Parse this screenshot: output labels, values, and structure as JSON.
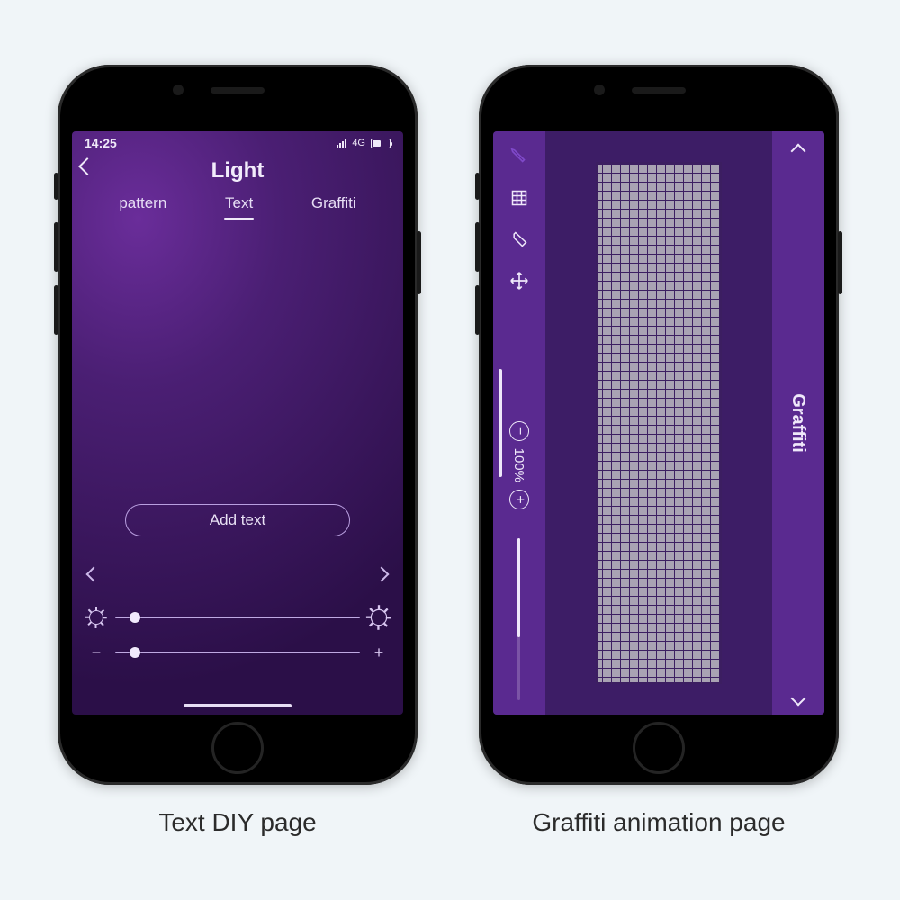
{
  "phone_text": {
    "status": {
      "time": "14:25",
      "network": "4G"
    },
    "title": "Light",
    "tabs": {
      "pattern": "pattern",
      "text": "Text",
      "graffiti": "Graffiti",
      "active": "text"
    },
    "add_text_label": "Add text",
    "sliders": {
      "brightness": {
        "value_pct": 6
      },
      "speed": {
        "value_pct": 6
      }
    }
  },
  "phone_graffiti": {
    "title": "Graffiti",
    "zoom": {
      "label": "100%",
      "min_glyph": "−",
      "max_glyph": "+"
    },
    "grid": {
      "cols": 58,
      "rows": 14
    }
  },
  "captions": {
    "text_page": "Text DIY page",
    "graffiti_page": "Graffiti animation page"
  }
}
